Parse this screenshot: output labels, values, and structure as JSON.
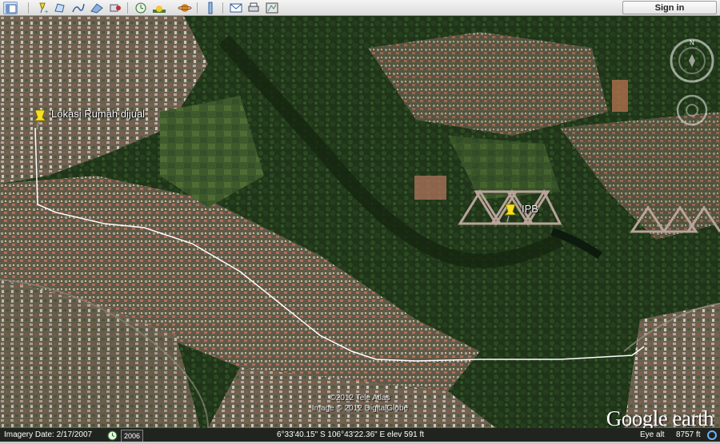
{
  "toolbar": {
    "buttons": [
      {
        "name": "sidebar-toggle-button",
        "icon": "sidebar-icon"
      },
      {
        "name": "add-placemark-button",
        "icon": "placemark-add-icon"
      },
      {
        "name": "add-polygon-button",
        "icon": "polygon-icon"
      },
      {
        "name": "add-path-button",
        "icon": "path-icon"
      },
      {
        "name": "add-overlay-button",
        "icon": "image-overlay-icon"
      },
      {
        "name": "record-tour-button",
        "icon": "tour-icon"
      },
      {
        "name": "historical-imagery-button",
        "icon": "clock-icon"
      },
      {
        "name": "sunlight-button",
        "icon": "sun-icon"
      },
      {
        "name": "switch-planet-button",
        "icon": "planet-icon"
      },
      {
        "name": "ruler-button",
        "icon": "ruler-icon"
      },
      {
        "name": "email-button",
        "icon": "email-icon"
      },
      {
        "name": "print-button",
        "icon": "print-icon"
      },
      {
        "name": "view-in-maps-button",
        "icon": "maps-icon"
      }
    ],
    "sign_in": "Sign in"
  },
  "map": {
    "placemarks": [
      {
        "label": "Lokasi Rumah dijual",
        "icon": "yellow-pushpin-icon"
      },
      {
        "label": "IPB",
        "icon": "yellow-pushpin-icon"
      }
    ],
    "copyright_line1": "©2012 Tele Atlas",
    "copyright_line2": "Image © 2012 DigitalGlobe",
    "logo_google": "Google",
    "logo_earth": " earth",
    "path_color": "#ffffff"
  },
  "status": {
    "imagery_date": "Imagery Date: 2/17/2007",
    "year": "2006",
    "coordinates": "6°33'40.15\" S  106°43'22.36\" E  elev   591 ft",
    "eye_alt_label": "Eye alt",
    "eye_alt_value": "8757 ft"
  }
}
